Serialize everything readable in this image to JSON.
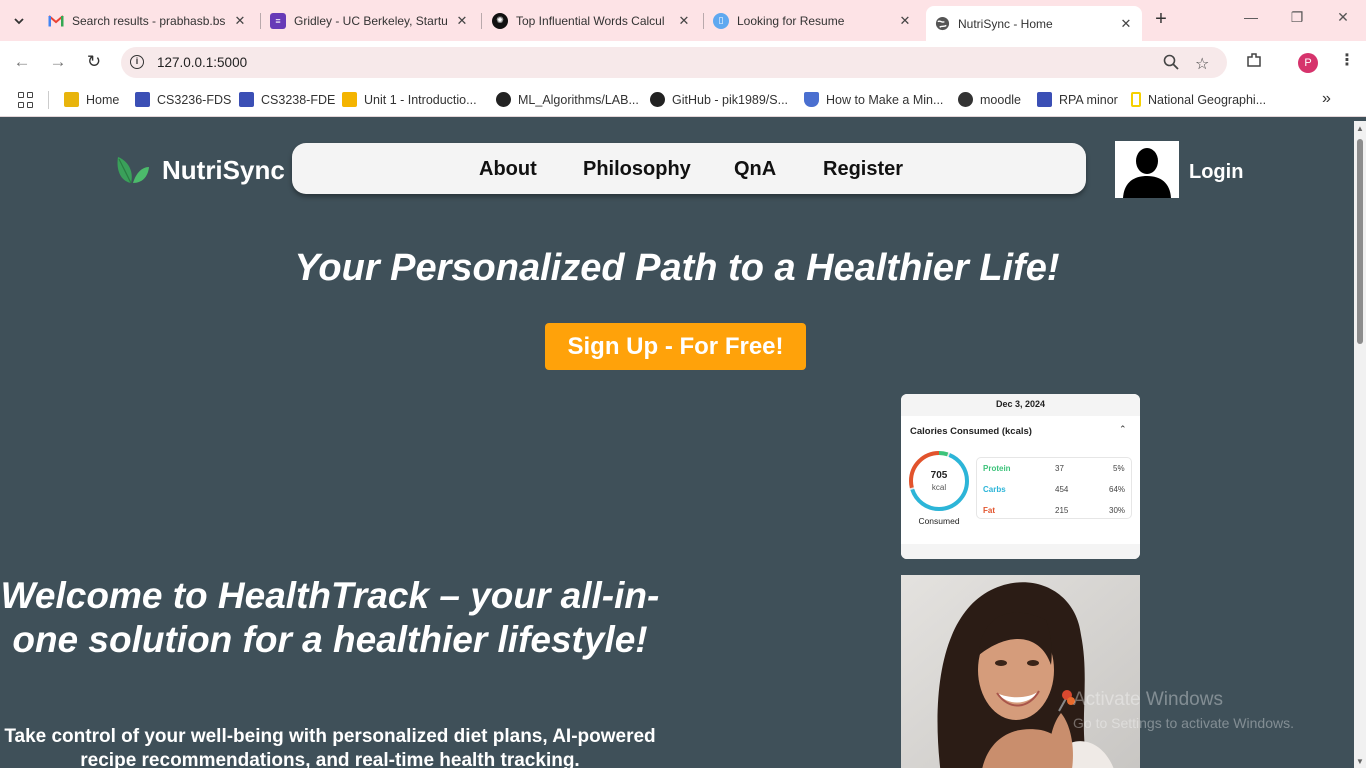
{
  "browser": {
    "tabs": [
      {
        "title": "Search results - prabhasb.bs",
        "icon": "gmail-icon"
      },
      {
        "title": "Gridley - UC Berkeley, Startu",
        "icon": "forms-icon"
      },
      {
        "title": "Top Influential Words Calcul",
        "icon": "chatgpt-icon"
      },
      {
        "title": "Looking for Resume",
        "icon": "doc-icon"
      },
      {
        "title": "NutriSync - Home",
        "icon": "globe-icon"
      }
    ],
    "url": "127.0.0.1:5000",
    "profile_initial": "P",
    "bookmarks": [
      {
        "label": "Home",
        "color": "#e8b40c"
      },
      {
        "label": "CS3236-FDS",
        "color": "#3b4fb5"
      },
      {
        "label": "CS3238-FDE",
        "color": "#3b4fb5"
      },
      {
        "label": "Unit 1 - Introductio...",
        "color": "#f4b400"
      },
      {
        "label": "ML_Algorithms/LAB...",
        "color": "#222222"
      },
      {
        "label": "GitHub - pik1989/S...",
        "color": "#222222"
      },
      {
        "label": "How to Make a Min...",
        "color": "#4a6fd0"
      },
      {
        "label": "moodle",
        "color": "#333333"
      },
      {
        "label": "RPA minor",
        "color": "#3b4fb5"
      },
      {
        "label": "National Geographi...",
        "color": "#f5d000"
      }
    ]
  },
  "site": {
    "brand": "NutriSync",
    "nav": [
      "About",
      "Philosophy",
      "QnA",
      "Register"
    ],
    "login": "Login",
    "hero_title": "Your Personalized Path to a Healthier Life!",
    "signup_label": "Sign Up - For Free!",
    "welcome": "Welcome to HealthTrack – your all-in-one solution for a healthier lifestyle!",
    "subtext": "Take control of your well-being with personalized diet plans, AI-powered recipe recommendations, and real-time health tracking."
  },
  "card": {
    "date": "Dec 3, 2024",
    "title": "Calories Consumed (kcals)",
    "kcal_value": "705",
    "kcal_unit": "kcal",
    "consumed_label": "Consumed",
    "macros": [
      {
        "name": "Protein",
        "grams": "37",
        "percent": "5%",
        "color": "#3cc37a"
      },
      {
        "name": "Carbs",
        "grams": "454",
        "percent": "64%",
        "color": "#2cb5d8"
      },
      {
        "name": "Fat",
        "grams": "215",
        "percent": "30%",
        "color": "#e2532c"
      }
    ]
  },
  "watermark": {
    "line1": "Activate Windows",
    "line2": "Go to Settings to activate Windows."
  }
}
